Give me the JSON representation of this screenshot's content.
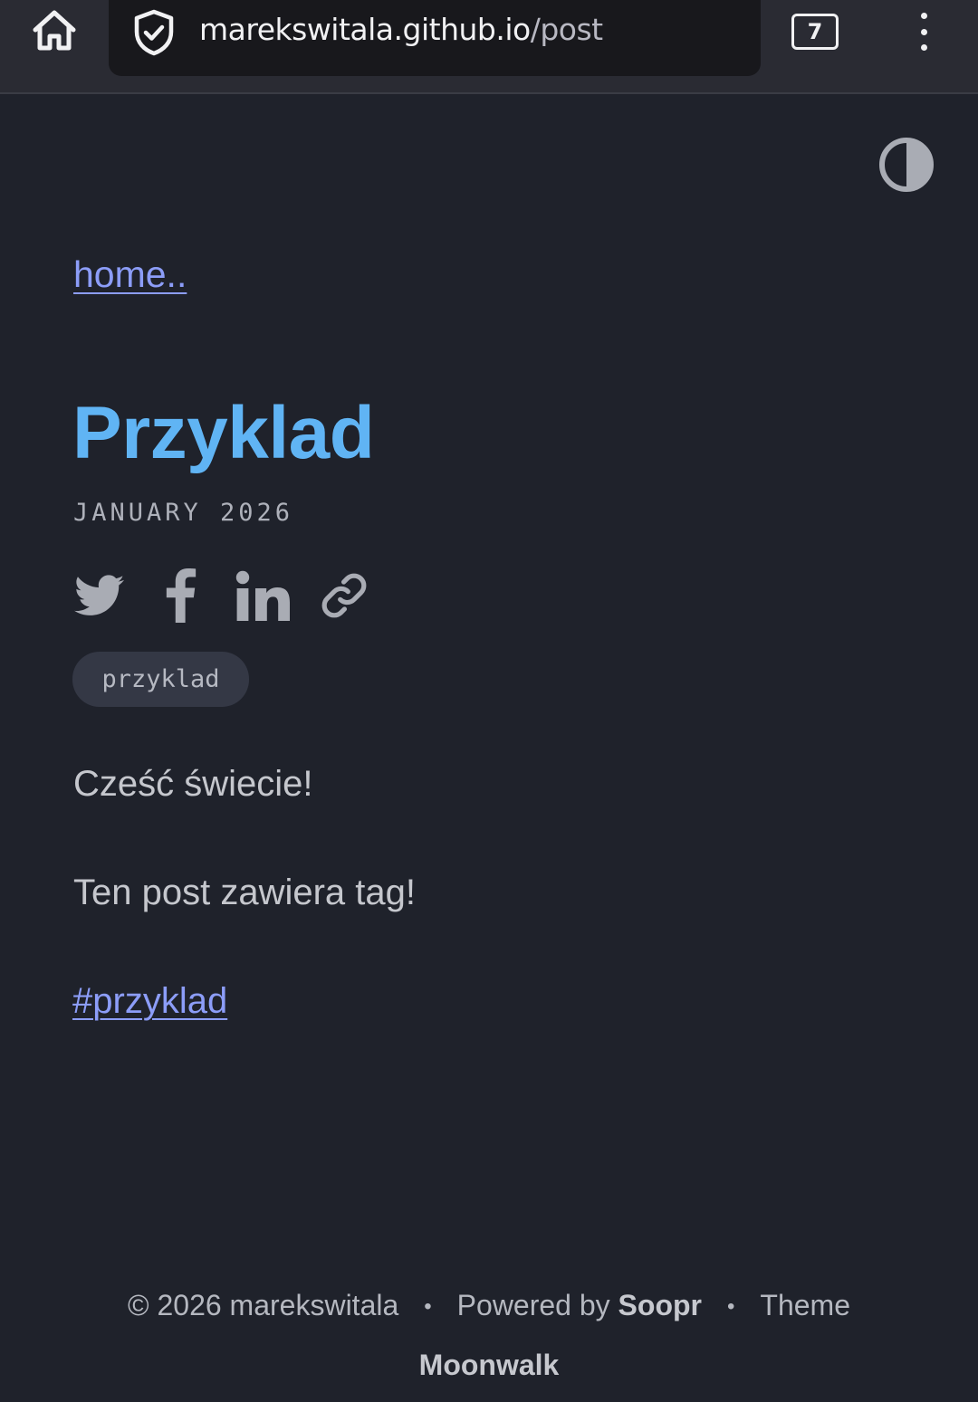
{
  "browser": {
    "url_domain": "marekswitala.github.io",
    "url_path": "/post",
    "tab_count": "7"
  },
  "page": {
    "home_link": "home..",
    "title": "Przyklad",
    "date": "JANUARY 2026",
    "share": {
      "icons": [
        "twitter-icon",
        "facebook-icon",
        "linkedin-icon",
        "link-icon"
      ]
    },
    "tag": "przyklad",
    "paragraphs": [
      "Cześć świecie!",
      "Ten post zawiera tag!"
    ],
    "hashtag_link": "#przyklad"
  },
  "footer": {
    "copyright": "© 2026 marekswitala",
    "powered_prefix": "Powered by",
    "powered_name": "Soopr",
    "theme_prefix": "Theme",
    "theme_name": "Moonwalk",
    "separator": "•"
  },
  "colors": {
    "background": "#1f222b",
    "title": "#60b4f4",
    "link": "#8c9df8",
    "text": "#c5c7cd",
    "icon": "#a9acb4"
  }
}
